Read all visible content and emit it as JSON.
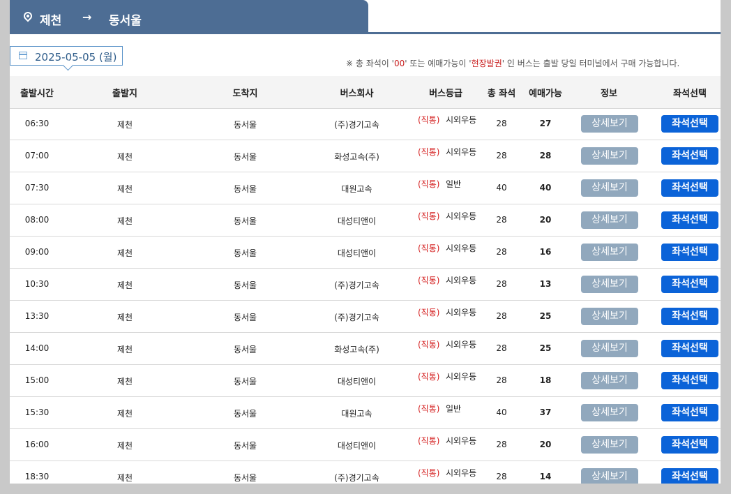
{
  "route": {
    "from": "제천",
    "arrow": "→",
    "to": "동서울"
  },
  "date": "2025-05-05 (월)",
  "notice": {
    "prefix": "※ 총 좌석이 '",
    "zero": "00",
    "mid": "' 또는 예매가능이 '",
    "onsite": "현장발권",
    "suffix": "' 인 버스는 출발 당일 터미널에서 구매 가능합니다."
  },
  "headers": {
    "time": "출발시간",
    "dep": "출발지",
    "arr": "도착지",
    "company": "버스회사",
    "grade": "버스등급",
    "total": "총 좌석",
    "avail": "예매가능",
    "info": "정보",
    "seat": "좌석선택"
  },
  "labels": {
    "detail": "상세보기",
    "seat": "좌석선택"
  },
  "colors": {
    "header_bar": "#4d6d94",
    "seat_button": "#0b63d8",
    "detail_button": "#91a8bd",
    "direct_label": "#d41c1c"
  },
  "rows": [
    {
      "time": "06:30",
      "dep": "제천",
      "arr": "동서울",
      "company": "(주)경기고속",
      "grade": "시외우등",
      "sub": "(직통)",
      "total": "28",
      "avail": "27"
    },
    {
      "time": "07:00",
      "dep": "제천",
      "arr": "동서울",
      "company": "화성고속(주)",
      "grade": "시외우등",
      "sub": "(직통)",
      "total": "28",
      "avail": "28"
    },
    {
      "time": "07:30",
      "dep": "제천",
      "arr": "동서울",
      "company": "대원고속",
      "grade": "일반",
      "sub": "(직통)",
      "total": "40",
      "avail": "40"
    },
    {
      "time": "08:00",
      "dep": "제천",
      "arr": "동서울",
      "company": "대성티앤이",
      "grade": "시외우등",
      "sub": "(직통)",
      "total": "28",
      "avail": "20"
    },
    {
      "time": "09:00",
      "dep": "제천",
      "arr": "동서울",
      "company": "대성티앤이",
      "grade": "시외우등",
      "sub": "(직통)",
      "total": "28",
      "avail": "16"
    },
    {
      "time": "10:30",
      "dep": "제천",
      "arr": "동서울",
      "company": "(주)경기고속",
      "grade": "시외우등",
      "sub": "(직통)",
      "total": "28",
      "avail": "13"
    },
    {
      "time": "13:30",
      "dep": "제천",
      "arr": "동서울",
      "company": "(주)경기고속",
      "grade": "시외우등",
      "sub": "(직통)",
      "total": "28",
      "avail": "25"
    },
    {
      "time": "14:00",
      "dep": "제천",
      "arr": "동서울",
      "company": "화성고속(주)",
      "grade": "시외우등",
      "sub": "(직통)",
      "total": "28",
      "avail": "25"
    },
    {
      "time": "15:00",
      "dep": "제천",
      "arr": "동서울",
      "company": "대성티앤이",
      "grade": "시외우등",
      "sub": "(직통)",
      "total": "28",
      "avail": "18"
    },
    {
      "time": "15:30",
      "dep": "제천",
      "arr": "동서울",
      "company": "대원고속",
      "grade": "일반",
      "sub": "(직통)",
      "total": "40",
      "avail": "37"
    },
    {
      "time": "16:00",
      "dep": "제천",
      "arr": "동서울",
      "company": "대성티앤이",
      "grade": "시외우등",
      "sub": "(직통)",
      "total": "28",
      "avail": "20"
    },
    {
      "time": "18:30",
      "dep": "제천",
      "arr": "동서울",
      "company": "(주)경기고속",
      "grade": "시외우등",
      "sub": "(직통)",
      "total": "28",
      "avail": "14"
    }
  ]
}
